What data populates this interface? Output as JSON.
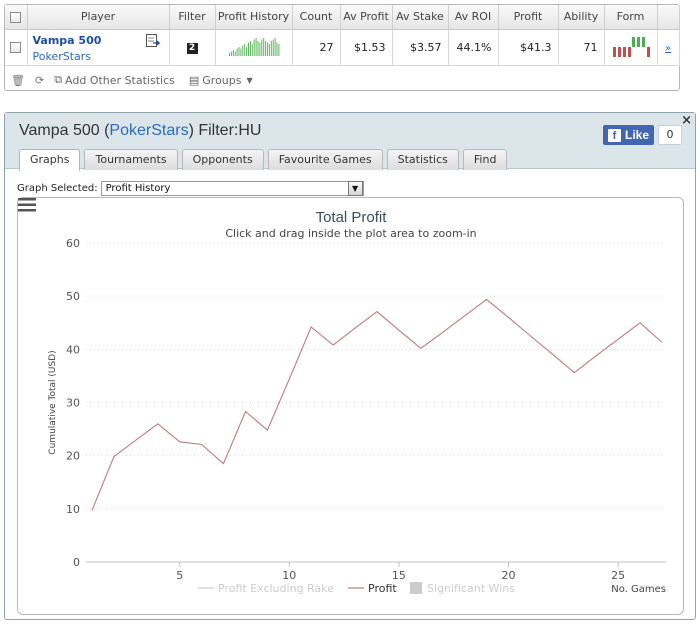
{
  "stats": {
    "headers": [
      "Player",
      "Filter",
      "Profit History",
      "Count",
      "Av Profit",
      "Av Stake",
      "Av ROI",
      "Profit",
      "Ability",
      "Form"
    ],
    "row": {
      "player_name": "Vampa 500",
      "site": "PokerStars",
      "filter_badge": "2",
      "count": "27",
      "av_profit": "$1.53",
      "av_stake": "$3.57",
      "av_roi": "44.1%",
      "profit": "$41.3",
      "ability": "71",
      "expand": "»"
    },
    "toolbar": {
      "add_stats_label": "Add Other Statistics",
      "groups_label": "Groups"
    },
    "sparkline_values": [
      2,
      3,
      4,
      3,
      5,
      6,
      5,
      7,
      8,
      6,
      9,
      10,
      8,
      11,
      12,
      10,
      9,
      11,
      12,
      10,
      9,
      8,
      10,
      11,
      12,
      9,
      8
    ]
  },
  "panel": {
    "title_player": "Vampa 500 (",
    "title_site": "PokerStars",
    "title_filter": ") Filter:HU",
    "close_label": "×",
    "fb_like_label": "Like",
    "fb_count": "0",
    "tabs": [
      {
        "label": "Graphs",
        "active": true
      },
      {
        "label": "Tournaments",
        "active": false
      },
      {
        "label": "Opponents",
        "active": false
      },
      {
        "label": "Favourite Games",
        "active": false
      },
      {
        "label": "Statistics",
        "active": false
      },
      {
        "label": "Find",
        "active": false
      }
    ],
    "graph_selected_label": "Graph Selected:",
    "graph_selected_value": "Profit History"
  },
  "colors": {
    "profit_line": "#c17a7a",
    "rake_line": "#cccccc",
    "sig_wins": "#cccccc",
    "grid": "#d4d4d4"
  },
  "chart_data": {
    "type": "line",
    "title": "Total Profit",
    "subtitle": "Click and drag inside the plot area to zoom-in",
    "ylabel": "Cumulative Total (USD)",
    "xlabel": "No. Games",
    "ylim": [
      0,
      60
    ],
    "xlim": [
      1,
      27
    ],
    "yticks": [
      0,
      10,
      20,
      30,
      40,
      50,
      60
    ],
    "xticks": [
      5,
      10,
      15,
      20,
      25
    ],
    "grid": true,
    "legend_position": "bottom",
    "legend": [
      "Profit Excluding Rake",
      "Profit",
      "Significant Wins"
    ],
    "series": [
      {
        "name": "Profit",
        "x": [
          1,
          2,
          3,
          4,
          5,
          6,
          7,
          8,
          9,
          10,
          11,
          12,
          13,
          14,
          15,
          16,
          17,
          18,
          19,
          20,
          21,
          22,
          23,
          24,
          25,
          26,
          27
        ],
        "y": [
          9.7,
          19.8,
          22.9,
          26.0,
          22.6,
          22.1,
          18.5,
          28.3,
          24.8,
          34.4,
          44.2,
          40.8,
          44.0,
          47.1,
          43.6,
          40.2,
          43.2,
          46.3,
          49.4,
          46.0,
          42.5,
          39.1,
          35.6,
          38.8,
          41.9,
          45.0,
          41.3
        ]
      }
    ]
  }
}
